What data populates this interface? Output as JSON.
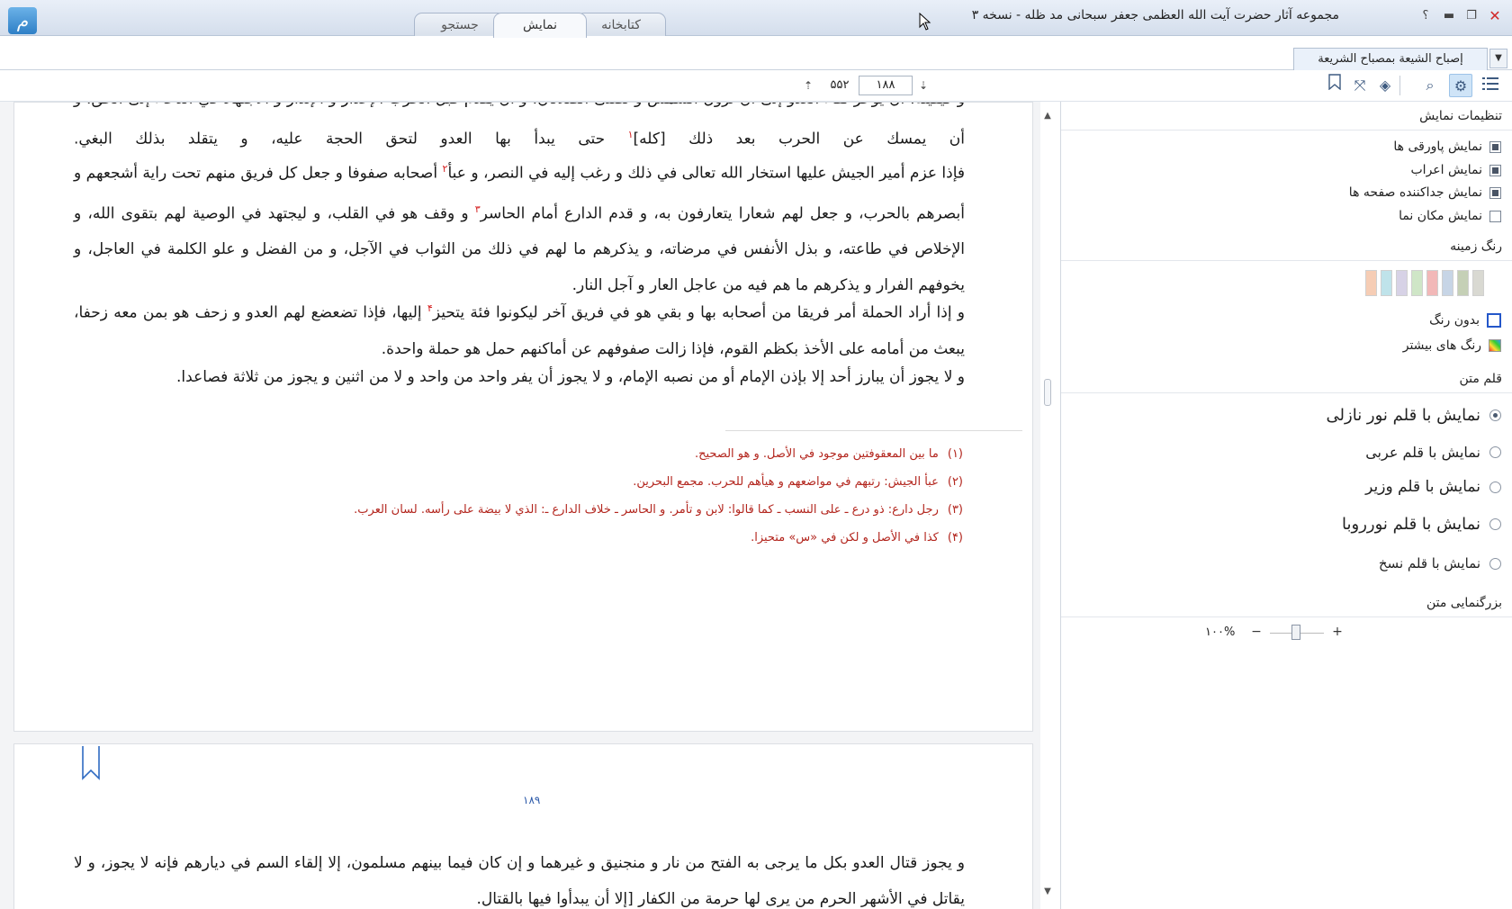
{
  "app": {
    "title": "مجموعه آثار حضرت آیت الله العظمی جعفر سبحانی مد ظله - نسخه ۳",
    "tabs": [
      {
        "label": "کتابخانه"
      },
      {
        "label": "نمایش"
      },
      {
        "label": "جستجو"
      }
    ],
    "help_label": "؟",
    "icons": [
      "logo-icon",
      "help-icon",
      "minimize-icon",
      "restore-icon",
      "close-icon"
    ]
  },
  "document": {
    "tab_label": "إصباح الشيعة بمصباح الشريعة"
  },
  "nav": {
    "current_page": "۱۸۸",
    "total_pages": "۵۵۲"
  },
  "page1": {
    "paragraphs": [
      "و كيفيته: أن يؤخر لقاء العدو إلى أن تزول الشمس و تصلى الصلاتان، و أن يقدم قبل الحرب الإعذار و الإنذار و الاجتهاد في الدعاء إلى الحق، و أن يمسك عن الحرب بعد ذلك [كله]",
      "فإذا عزم أمير الجيش عليها استخار الله تعالى في ذلك و رغب إليه في النصر، و عبأ",
      "و إذا أراد الحملة أمر فريقا من أصحابه بها و بقي هو في فريق آخر ليكونوا فئة يتحيز",
      "و لا يجوز أن يبارز أحد إلا بإذن الإمام أو من نصبه الإمام، و لا يجوز أن يفر واحد من واحد و لا من اثنين و يجوز من ثلاثة فصاعدا."
    ],
    "p1_tail": "حتى يبدأ بها العدو لتحق الحجة عليه، و يتقلد بذلك البغي.",
    "p2_tail": "أصحابه صفوفا و جعل كل فريق منهم تحت راية أشجعهم و أبصرهم بالحرب، و جعل لهم شعارا يتعارفون به، و قدم الدارع أمام الحاسر",
    "p2_tail2": "و وقف هو في القلب، و ليجتهد في الوصية لهم بتقوى الله، و الإخلاص في طاعته، و بذل الأنفس في مرضاته، و يذكرهم ما لهم في ذلك من الثواب في الآجل، و من الفضل و علو الكلمة في العاجل، و يخوفهم الفرار و يذكرهم ما هم فيه من عاجل العار و آجل النار.",
    "p3_tail": "إليها، فإذا تضعضع لهم العدو و زحف هو بمن معه زحفا، يبعث من أمامه على الأخذ بكظم القوم، فإذا زالت صفوفهم عن أماكنهم حمل هو حملة واحدة.",
    "footnote_markers": [
      "۱",
      "۲",
      "۳",
      "۴"
    ],
    "footnotes": [
      {
        "num": "(۱)",
        "text": "ما بين المعقوفتين موجود في الأصل. و هو الصحيح."
      },
      {
        "num": "(۲)",
        "text": "عبأ الجيش: رتبهم في مواضعهم و هيأهم للحرب. مجمع البحرين."
      },
      {
        "num": "(۳)",
        "text": "رجل دارع: ذو درع ـ على النسب ـ كما قالوا: لابن و تأمر. و الحاسر ـ خلاف الدارع ـ: الذي لا بيضة على رأسه. لسان العرب."
      },
      {
        "num": "(۴)",
        "text": "كذا في الأصل و لكن في «س» متحيزا."
      }
    ]
  },
  "page2": {
    "page_number": "۱۸۹",
    "paragraphs": [
      "و يجوز قتال العدو بكل ما يرجى به الفتح من نار و منجنيق و غيرهما و إن كان فيما بينهم مسلمون، إلا إلقاء السم في ديارهم فإنه لا يجوز، و لا يقاتل في الأشهر الحرم من يرى لها حرمة من الكفار [إلا أن يبدأوا فيها بالقتال."
    ]
  },
  "settings": {
    "display_header": "تنظیمات نمایش",
    "checkboxes": [
      {
        "label": "نمایش پاورقی ها",
        "checked": true
      },
      {
        "label": "نمایش اعراب",
        "checked": true
      },
      {
        "label": "نمایش جداکننده صفحه ها",
        "checked": true
      },
      {
        "label": "نمایش مکان نما",
        "checked": false
      }
    ],
    "bg_header": "رنگ زمینه",
    "swatch_colors": [
      "#d9d9d2",
      "#c5d0b6",
      "#c7d5e6",
      "#f2b8b8",
      "#cfe6c7",
      "#d7d2e6",
      "#bfe3ea",
      "#f6cdb5"
    ],
    "no_color_label": "بدون رنگ",
    "more_colors_label": "رنگ های بیشتر",
    "font_header": "قلم متن",
    "fonts": [
      {
        "label": "نمایش با قلم نور نازلی",
        "selected": true
      },
      {
        "label": "نمایش با قلم عربی",
        "selected": false
      },
      {
        "label": "نمایش با قلم وزیر",
        "selected": false
      },
      {
        "label": "نمایش با قلم نورروبا",
        "selected": false
      },
      {
        "label": "نمایش با قلم نسخ",
        "selected": false
      }
    ],
    "zoom_header": "بزرگنمایی متن",
    "zoom_value": "۱۰۰%",
    "zoom_minus": "−",
    "zoom_plus": "+"
  }
}
